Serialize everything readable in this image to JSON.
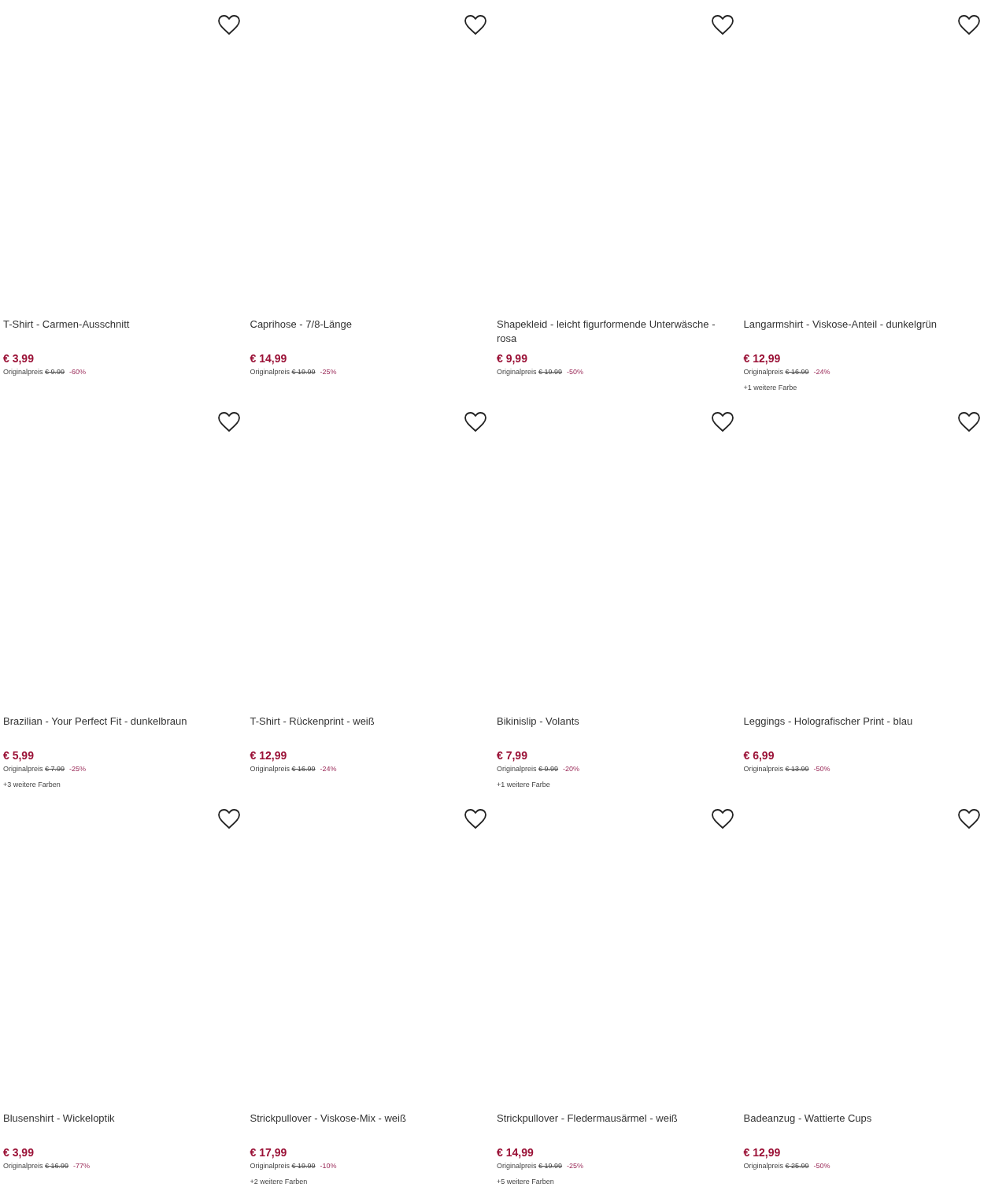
{
  "products": [
    {
      "title": "T-Shirt - Carmen-Ausschnitt",
      "price": "€ 3,99",
      "original_label": "Originalpreis",
      "original_price": "€ 9.99",
      "discount": "-60%"
    },
    {
      "title": "Caprihose - 7/8-Länge",
      "price": "€ 14,99",
      "original_label": "Originalpreis",
      "original_price": "€ 19.99",
      "discount": "-25%"
    },
    {
      "title": "Shapekleid - leicht figurformende Unterwäsche - rosa",
      "price": "€ 9,99",
      "original_label": "Originalpreis",
      "original_price": "€ 19.99",
      "discount": "-50%"
    },
    {
      "title": "Langarmshirt - Viskose-Anteil - dunkelgrün",
      "price": "€ 12,99",
      "original_label": "Originalpreis",
      "original_price": "€ 16.99",
      "discount": "-24%",
      "more_colors": "+1 weitere Farbe"
    },
    {
      "title": "Brazilian - Your Perfect Fit - dunkelbraun",
      "price": "€ 5,99",
      "original_label": "Originalpreis",
      "original_price": "€ 7.99",
      "discount": "-25%",
      "more_colors": "+3 weitere Farben"
    },
    {
      "title": "T-Shirt - Rückenprint - weiß",
      "price": "€ 12,99",
      "original_label": "Originalpreis",
      "original_price": "€ 16.99",
      "discount": "-24%"
    },
    {
      "title": "Bikinislip - Volants",
      "price": "€ 7,99",
      "original_label": "Originalpreis",
      "original_price": "€ 9.99",
      "discount": "-20%",
      "more_colors": "+1 weitere Farbe"
    },
    {
      "title": "Leggings - Holografischer Print - blau",
      "price": "€ 6,99",
      "original_label": "Originalpreis",
      "original_price": "€ 13.99",
      "discount": "-50%"
    },
    {
      "title": "Blusenshirt - Wickeloptik",
      "price": "€ 3,99",
      "original_label": "Originalpreis",
      "original_price": "€ 16.99",
      "discount": "-77%"
    },
    {
      "title": "Strickpullover - Viskose-Mix - weiß",
      "price": "€ 17,99",
      "original_label": "Originalpreis",
      "original_price": "€ 19.99",
      "discount": "-10%",
      "more_colors": "+2 weitere Farben"
    },
    {
      "title": "Strickpullover - Fledermausärmel - weiß",
      "price": "€ 14,99",
      "original_label": "Originalpreis",
      "original_price": "€ 19.99",
      "discount": "-25%",
      "more_colors": "+5 weitere Farben"
    },
    {
      "title": "Badeanzug - Wattierte Cups",
      "price": "€ 12,99",
      "original_label": "Originalpreis",
      "original_price": "€ 25.99",
      "discount": "-50%"
    }
  ]
}
